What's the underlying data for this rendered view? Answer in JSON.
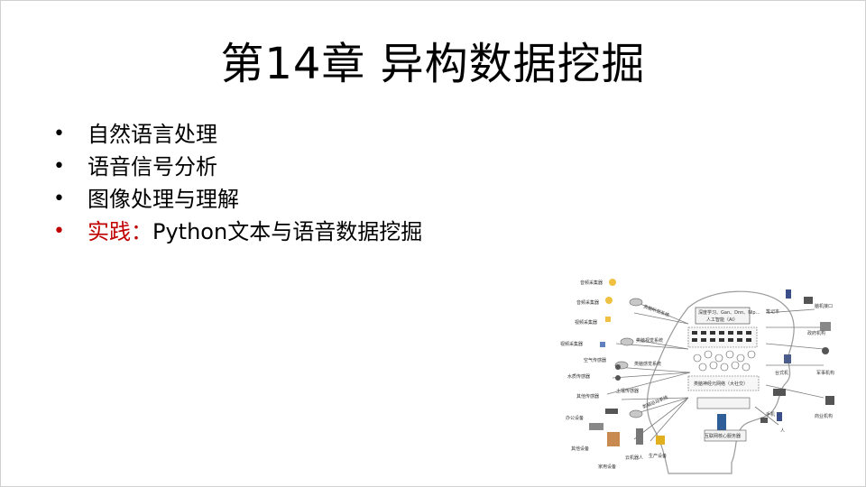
{
  "slide": {
    "title": "第14章 异构数据挖掘",
    "bullets": [
      {
        "text": "自然语言处理"
      },
      {
        "text": "语音信号分析"
      },
      {
        "text": "图像处理与理解"
      },
      {
        "highlight": "实践：",
        "text": "Python文本与语音数据挖掘"
      }
    ],
    "bullet_glyph": "•",
    "accent_color": "#c00000"
  },
  "diagram": {
    "center": [
      "深度学习、Gan、Dnn、Nlp…",
      "人工智能（AI）",
      "类脑神经元网络（大社交）",
      "互联网核心服务器"
    ],
    "systems": [
      "类脑听觉系统",
      "类脑视觉系统",
      "类脑感觉系统",
      "类脑运动系统"
    ],
    "devices_left": [
      "音频采集器",
      "音频采集器",
      "视频采集器",
      "视频采集器",
      "空气传感器",
      "水质传感器",
      "土壤传感器",
      "其他传感器",
      "办公设备",
      "其他设备",
      "家用设备",
      "云机器人",
      "生产设备"
    ],
    "devices_right": [
      "笔记本",
      "脑机接口",
      "政府机构",
      "台式机",
      "军事机构",
      "商业机构",
      "手机",
      "人"
    ]
  }
}
